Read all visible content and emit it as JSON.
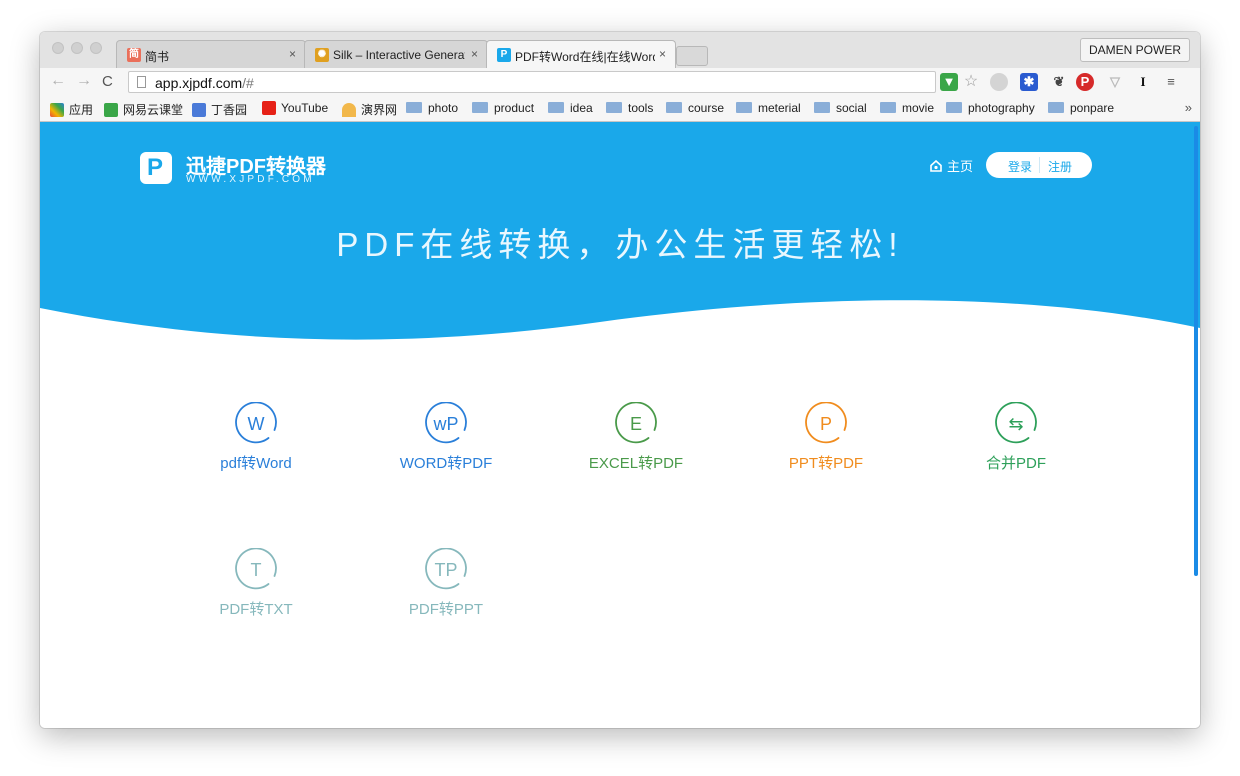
{
  "browser": {
    "tabs": [
      {
        "title": "简书",
        "favicon_color": "#ea6f5a",
        "favicon_text": "简"
      },
      {
        "title": "Silk – Interactive Generativ",
        "favicon_color": "#e0a020",
        "favicon_text": "✺"
      },
      {
        "title": "PDF转Word在线|在线Word转",
        "favicon_color": "#1aa8ea",
        "favicon_text": "P"
      }
    ],
    "close_glyph": "×",
    "profile_name": "DAMEN POWER",
    "url_host": "app.xjpdf.com",
    "url_path": "/#",
    "bookmarks": [
      {
        "label": "应用",
        "icon": "apps-grid-icon"
      },
      {
        "label": "网易云课堂",
        "icon": "netease-icon"
      },
      {
        "label": "丁香园",
        "icon": "dxy-icon"
      },
      {
        "label": "YouTube",
        "icon": "youtube-icon"
      },
      {
        "label": "演界网",
        "icon": "yanjie-icon"
      },
      {
        "label": "photo",
        "icon": "folder-icon"
      },
      {
        "label": "product",
        "icon": "folder-icon"
      },
      {
        "label": "idea",
        "icon": "folder-icon"
      },
      {
        "label": "tools",
        "icon": "folder-icon"
      },
      {
        "label": "course",
        "icon": "folder-icon"
      },
      {
        "label": "meterial",
        "icon": "folder-icon"
      },
      {
        "label": "social",
        "icon": "folder-icon"
      },
      {
        "label": "movie",
        "icon": "folder-icon"
      },
      {
        "label": "photography",
        "icon": "folder-icon"
      },
      {
        "label": "ponpare",
        "icon": "folder-icon"
      }
    ],
    "bookmarks_overflow": "»"
  },
  "site": {
    "logo_name": "迅捷PDF转换器",
    "logo_sub": "WWW.XJPDF.COM",
    "nav_home": "主页",
    "login": "登录",
    "register": "注册",
    "headline": "PDF在线转换，办公生活更轻松!",
    "brand_color": "#1aa8ea",
    "tools": [
      {
        "glyph": "W",
        "label": "pdf转Word",
        "color": "#2a7fd9",
        "icon": "word-icon"
      },
      {
        "glyph": "wP",
        "label": "WORD转PDF",
        "color": "#2a7fd9",
        "icon": "word-to-pdf-icon"
      },
      {
        "glyph": "E",
        "label": "EXCEL转PDF",
        "color": "#4a9a4a",
        "icon": "excel-icon"
      },
      {
        "glyph": "P",
        "label": "PPT转PDF",
        "color": "#f08c1e",
        "icon": "ppt-icon"
      },
      {
        "glyph": "⇆",
        "label": "合并PDF",
        "color": "#2ea05a",
        "icon": "merge-icon"
      },
      {
        "glyph": "T",
        "label": "PDF转TXT",
        "color": "#86b8bc",
        "icon": "txt-icon"
      },
      {
        "glyph": "TP",
        "label": "PDF转PPT",
        "color": "#86b8bc",
        "icon": "pdf-to-ppt-icon"
      }
    ]
  }
}
